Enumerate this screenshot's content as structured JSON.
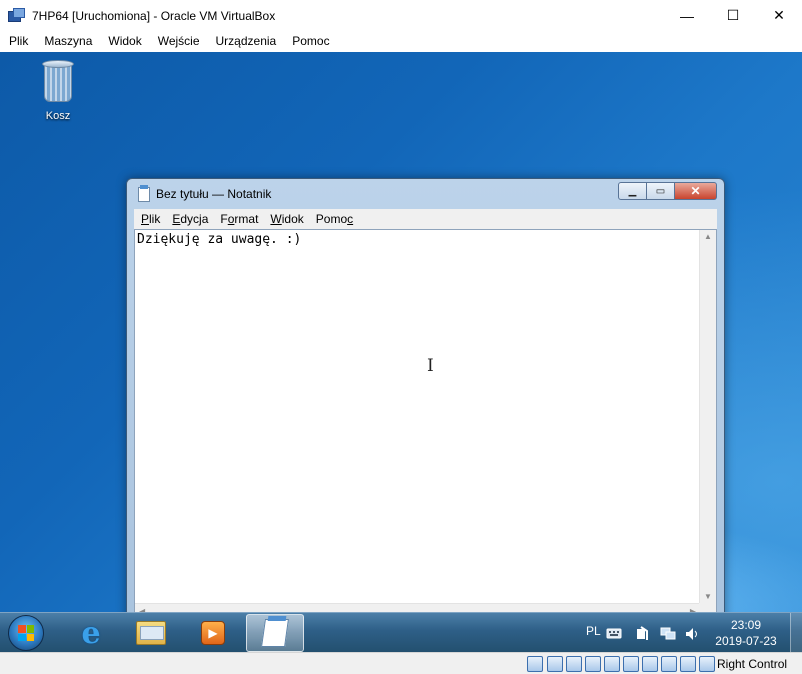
{
  "host_window": {
    "title": "7HP64 [Uruchomiona] - Oracle VM VirtualBox",
    "controls": {
      "minimize": "—",
      "maximize": "☐",
      "close": "✕"
    },
    "menu": [
      "Plik",
      "Maszyna",
      "Widok",
      "Wejście",
      "Urządzenia",
      "Pomoc"
    ]
  },
  "desktop": {
    "icons": [
      {
        "label": "Kosz",
        "icon": "recycle-bin-icon"
      }
    ]
  },
  "notepad": {
    "title": "Bez tytułu — Notatnik",
    "menu": [
      {
        "label": "Plik",
        "mnemonic": "P"
      },
      {
        "label": "Edycja",
        "mnemonic": "E"
      },
      {
        "label": "Format",
        "mnemonic": "o"
      },
      {
        "label": "Widok",
        "mnemonic": "W"
      },
      {
        "label": "Pomoc",
        "mnemonic": "c"
      }
    ],
    "content": "Dziękuję za uwagę. :)",
    "controls": {
      "minimize": "▁",
      "maximize": "▭",
      "close": "✕"
    }
  },
  "taskbar": {
    "pinned": [
      {
        "name": "internet-explorer",
        "icon": "ie-icon"
      },
      {
        "name": "windows-explorer",
        "icon": "folder-icon"
      },
      {
        "name": "windows-media-player",
        "icon": "media-player-icon"
      },
      {
        "name": "notepad",
        "icon": "notepad-icon",
        "active": true
      }
    ],
    "tray": {
      "language": "PL",
      "icons": [
        "keyboard-icon",
        "action-center-icon",
        "network-icon",
        "volume-icon"
      ],
      "time": "23:09",
      "date": "2019-07-23"
    }
  },
  "statusbar": {
    "host_key": "Right Control",
    "icons": [
      "hard-disk-icon",
      "optical-drive-icon",
      "audio-icon",
      "network-adapter-icon",
      "usb-icon",
      "shared-folders-icon",
      "display-icon",
      "recording-icon",
      "cpu-icon",
      "virtualization-icon",
      "guest-additions-icon",
      "host-key-arrow-icon"
    ]
  },
  "colors": {
    "desktop_base": "#1266b8",
    "taskbar": "#2e5f87",
    "notepad_frame": "#bcd3ea",
    "close_button": "#c9442e"
  }
}
